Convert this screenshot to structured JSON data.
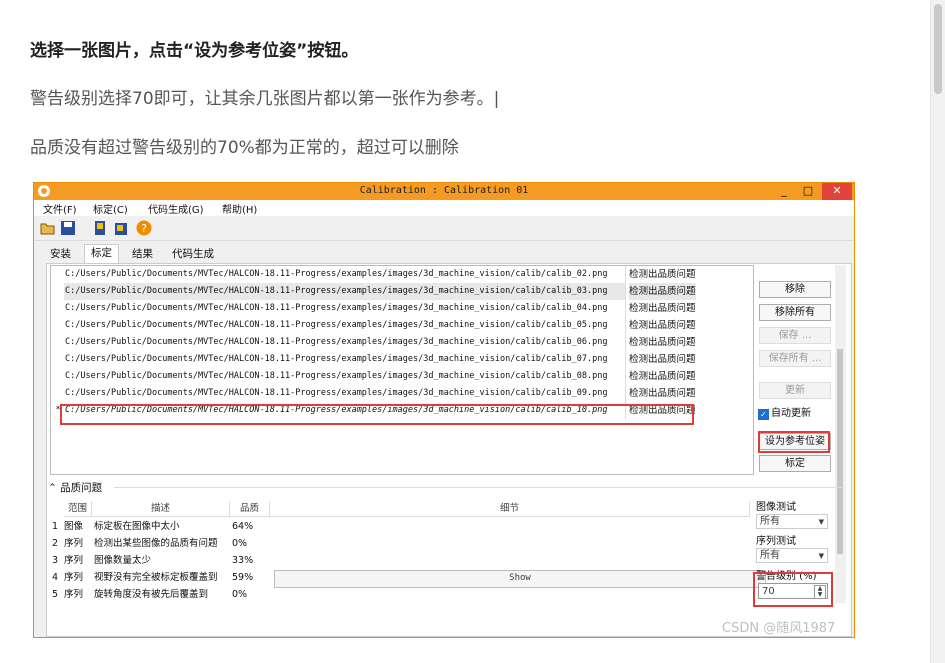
{
  "article": {
    "p1": "选择一张图片，点击“设为参考位姿”按钮。",
    "p2": "警告级别选择70即可，让其余几张图片都以第一张作为参考。|",
    "p3": "品质没有超过警告级别的70%都为正常的，超过可以删除"
  },
  "window": {
    "title": "Calibration : Calibration 01",
    "controls": {
      "minimize": "_",
      "maximize": "□",
      "close": "✕"
    }
  },
  "menu": [
    "文件(F)",
    "标定(C)",
    "代码生成(G)",
    "帮助(H)"
  ],
  "toolbar_icons": [
    "open-folder-icon",
    "save-icon",
    "load-icon",
    "export-icon",
    "help-icon"
  ],
  "tabs": [
    "安装",
    "标定",
    "结果",
    "代码生成"
  ],
  "files": [
    {
      "marker": "",
      "path": "C:/Users/Public/Documents/MVTec/HALCON-18.11-Progress/examples/images/3d_machine_vision/calib/calib_02.png",
      "status": "检测出品质问题"
    },
    {
      "marker": "",
      "path": "C:/Users/Public/Documents/MVTec/HALCON-18.11-Progress/examples/images/3d_machine_vision/calib/calib_03.png",
      "status": "检测出品质问题"
    },
    {
      "marker": "",
      "path": "C:/Users/Public/Documents/MVTec/HALCON-18.11-Progress/examples/images/3d_machine_vision/calib/calib_04.png",
      "status": "检测出品质问题"
    },
    {
      "marker": "",
      "path": "C:/Users/Public/Documents/MVTec/HALCON-18.11-Progress/examples/images/3d_machine_vision/calib/calib_05.png",
      "status": "检测出品质问题"
    },
    {
      "marker": "",
      "path": "C:/Users/Public/Documents/MVTec/HALCON-18.11-Progress/examples/images/3d_machine_vision/calib/calib_06.png",
      "status": "检测出品质问题"
    },
    {
      "marker": "",
      "path": "C:/Users/Public/Documents/MVTec/HALCON-18.11-Progress/examples/images/3d_machine_vision/calib/calib_07.png",
      "status": "检测出品质问题"
    },
    {
      "marker": "",
      "path": "C:/Users/Public/Documents/MVTec/HALCON-18.11-Progress/examples/images/3d_machine_vision/calib/calib_08.png",
      "status": "检测出品质问题"
    },
    {
      "marker": "",
      "path": "C:/Users/Public/Documents/MVTec/HALCON-18.11-Progress/examples/images/3d_machine_vision/calib/calib_09.png",
      "status": "检测出品质问题"
    },
    {
      "marker": "*",
      "path": "C:/Users/Public/Documents/MVTec/HALCON-18.11-Progress/examples/images/3d_machine_vision/calib/calib_10.png",
      "status": "检测出品质问题"
    }
  ],
  "buttons": {
    "remove": "移除",
    "remove_all": "移除所有",
    "save": "保存 ...",
    "save_all": "保存所有 ...",
    "update": "更新",
    "auto_update": "自动更新",
    "set_reference": "设为参考位姿",
    "calibrate": "标定"
  },
  "quality": {
    "section_title": "品质问题",
    "columns": [
      "范围",
      "描述",
      "品质",
      "细节"
    ],
    "rows": [
      {
        "n": "1",
        "scope": "图像",
        "desc": "标定板在图像中太小",
        "quality": "64%",
        "detail": ""
      },
      {
        "n": "2",
        "scope": "序列",
        "desc": "检测出某些图像的品质有问题",
        "quality": "0%",
        "detail": ""
      },
      {
        "n": "3",
        "scope": "序列",
        "desc": "图像数量太少",
        "quality": "33%",
        "detail": ""
      },
      {
        "n": "4",
        "scope": "序列",
        "desc": "视野没有完全被标定板覆盖到",
        "quality": "59%",
        "detail": "Show"
      },
      {
        "n": "5",
        "scope": "序列",
        "desc": "旋转角度没有被先后覆盖到",
        "quality": "0%",
        "detail": ""
      }
    ]
  },
  "side_settings": {
    "image_test_label": "图像测试",
    "image_test_value": "所有",
    "sequence_test_label": "序列测试",
    "sequence_test_value": "所有",
    "warning_level_label": "警告级别 (%)",
    "warning_level_value": "70"
  },
  "watermark": "CSDN @随风1987"
}
